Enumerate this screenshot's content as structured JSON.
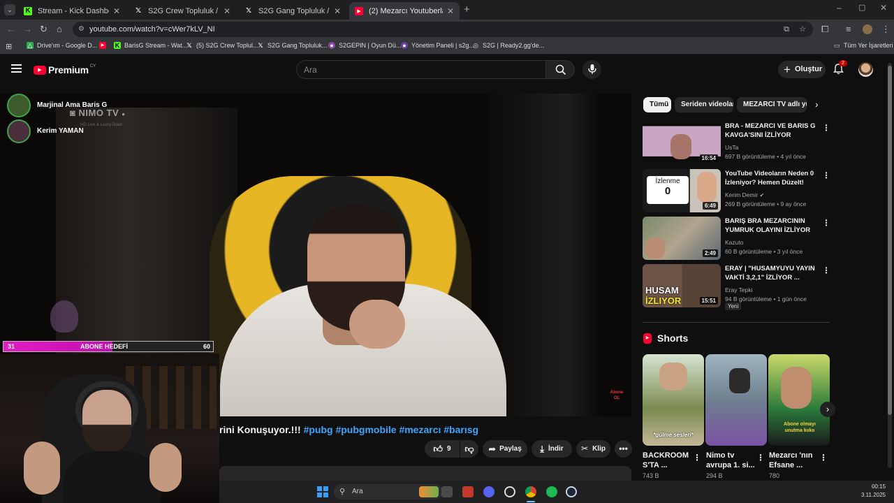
{
  "browser": {
    "tabs": [
      {
        "title": "Stream - Kick Dashboard",
        "icon": "kick-icon"
      },
      {
        "title": "S2G Crew Topluluk / X",
        "icon": "x-icon"
      },
      {
        "title": "S2G Gang Topluluk / X",
        "icon": "x-icon"
      },
      {
        "title": "(2) Mezarcı Youtuberlar Hakkında",
        "icon": "youtube-icon"
      }
    ],
    "url": "youtube.com/watch?v=cWer7kLV_NI",
    "bookmarks": [
      "Drive'ım - Google D...",
      "BarisG Stream - Wat...",
      "(5) S2G Crew Toplul...",
      "S2G Gang Topluluk...",
      "S2GEPIN | Oyun Dü...",
      "Yönetim Paneli | s2g...",
      "S2G | Ready2.gg'de..."
    ],
    "all_bookmarks": "Tüm Yer İşaretleri"
  },
  "youtube": {
    "logo": "Premium",
    "logo_country": "CY",
    "search_placeholder": "Ara",
    "create_label": "Oluştur",
    "notif_count": "2"
  },
  "overlay": {
    "viewers": [
      "Marjinal Ama Baris G",
      "Kerim YAMAN"
    ],
    "nimo": "NIMO TV",
    "nimo_sub": "HD Live & Lucky Draw",
    "sub_goal_current": "31",
    "sub_goal_label": "ABONE HEDEFİ",
    "sub_goal_target": "60",
    "sub_goal_progress": 0.52,
    "watermark": "Abone OL"
  },
  "video": {
    "title_visible": "rini Konuşuyor.!!! ",
    "hashtags": "#pubg #pubgmobile #mezarcı #barısg",
    "likes": "9",
    "share": "Paylaş",
    "download": "İndir",
    "clip": "Klip"
  },
  "chips": [
    "Tümü",
    "Seriden videolar",
    "MEZARCI TV adlı yük"
  ],
  "recommendations": [
    {
      "title": "BRA - MEZARCI VE BARIS G KAVGA'SINI İZLİYOR",
      "channel": "UsTa",
      "meta": "697 B görüntüleme • 4 yıl önce",
      "duration": "16:54",
      "verified": false
    },
    {
      "title": "YouTube Videoların Neden 0 İzleniyor? Hemen Düzelt!",
      "channel": "Kerim Demir",
      "meta": "269 B görüntüleme • 9 ay önce",
      "duration": "6:49",
      "verified": true,
      "thumb_text": "İzlenme",
      "thumb_num": "0"
    },
    {
      "title": "BARIŞ BRA MEZARCININ YUMRUK OLAYINI İZLİYOR VE ...",
      "channel": "Kazuto",
      "meta": "60 B görüntüleme • 3 yıl önce",
      "duration": "2:49",
      "verified": false
    },
    {
      "title": "ERAY | \"HUSAMYUYU YAYIN VAKTİ 3,2,1\" İZLİYOR ...",
      "channel": "Eray Tepki",
      "meta": "94 B görüntüleme • 1 gün önce",
      "duration": "15:51",
      "verified": false,
      "badge": "Yeni",
      "thumb_text": "HUSAM",
      "thumb_text2": "İZLIYOR"
    }
  ],
  "shorts": {
    "heading": "Shorts",
    "items": [
      {
        "title": "BACKROOM S'TA ...",
        "views": "743 B",
        "caption": "*gülme sesleri*"
      },
      {
        "title": "Nimo tv avrupa 1. si...",
        "views": "294 B",
        "caption": ""
      },
      {
        "title": "Mezarcı 'nın Efsane ...",
        "views": "780",
        "caption": "Abone olmayı unutma kııkıı"
      }
    ]
  },
  "taskbar": {
    "search": "Ara",
    "time": "00:15",
    "date": "3.11.2025"
  }
}
